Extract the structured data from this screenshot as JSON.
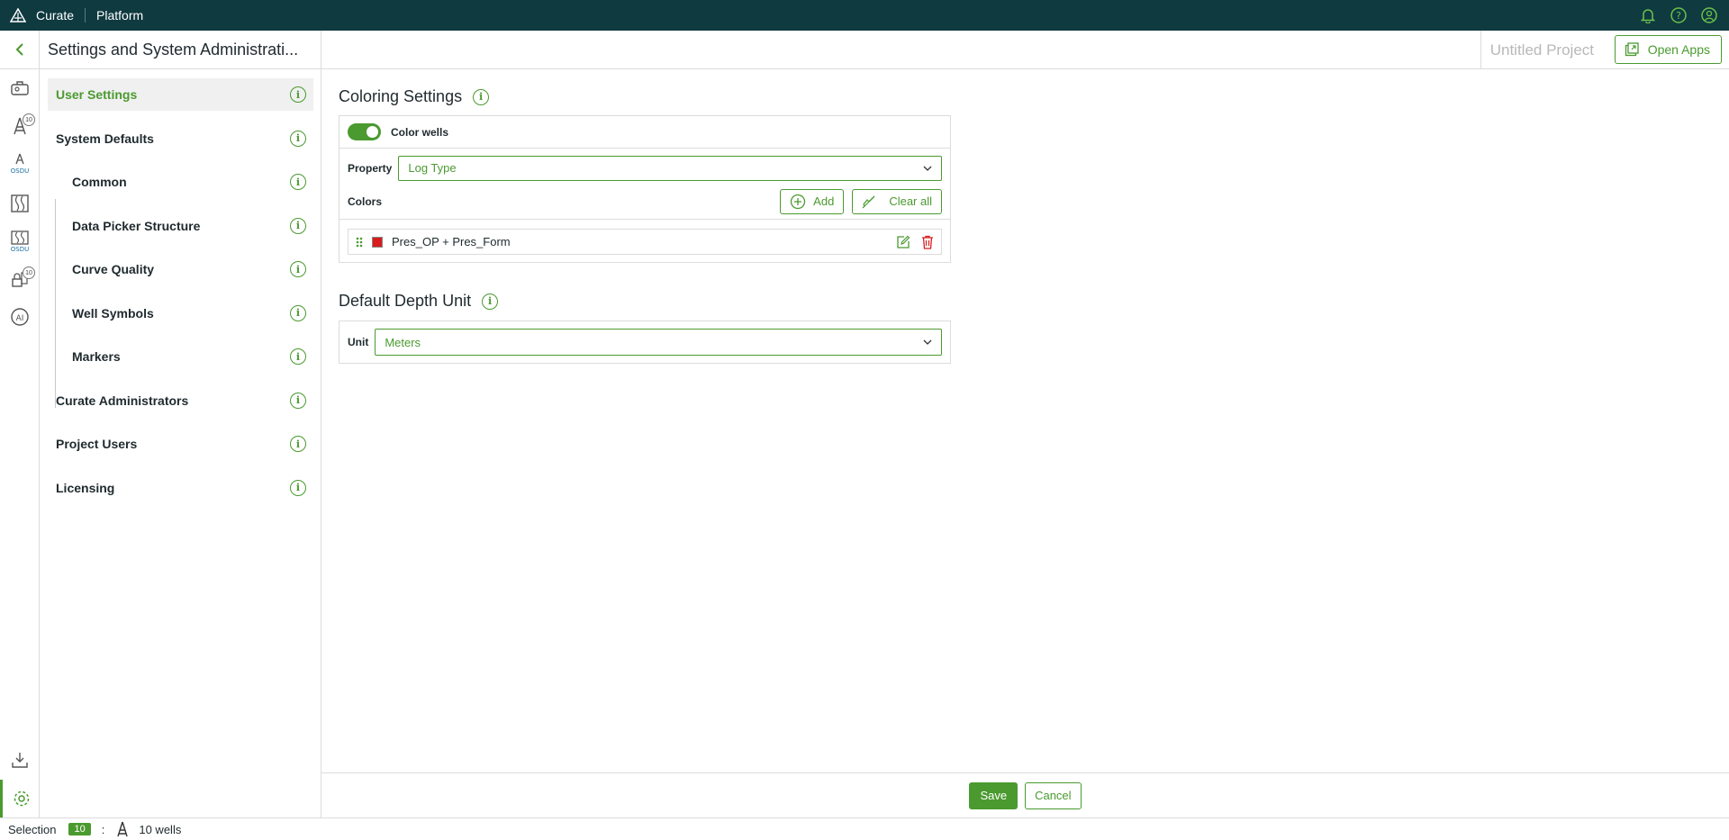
{
  "topbar": {
    "app_name": "Curate",
    "platform_label": "Platform"
  },
  "nav": {
    "title": "Settings and System Administrati...",
    "items": [
      {
        "label": "User Settings"
      },
      {
        "label": "System Defaults"
      },
      {
        "label": "Common"
      },
      {
        "label": "Data Picker Structure"
      },
      {
        "label": "Curve Quality"
      },
      {
        "label": "Well Symbols"
      },
      {
        "label": "Markers"
      },
      {
        "label": "Curate Administrators"
      },
      {
        "label": "Project Users"
      },
      {
        "label": "Licensing"
      }
    ]
  },
  "rail": {
    "badge_wells": "10",
    "badge_selection": "10",
    "osdu_label": "OSDU"
  },
  "header": {
    "project_name": "Untitled Project",
    "open_apps_label": "Open Apps"
  },
  "coloring": {
    "title": "Coloring Settings",
    "color_wells_label": "Color wells",
    "color_wells_on": true,
    "property_label": "Property",
    "property_value": "Log Type",
    "colors_label": "Colors",
    "add_label": "Add",
    "clear_label": "Clear all",
    "entries": [
      {
        "name": "Pres_OP + Pres_Form",
        "color": "#d91c1c"
      }
    ]
  },
  "depth": {
    "title": "Default Depth Unit",
    "unit_label": "Unit",
    "unit_value": "Meters"
  },
  "footer": {
    "save_label": "Save",
    "cancel_label": "Cancel"
  },
  "status": {
    "selection_label": "Selection",
    "selection_count": "10",
    "separator": ":",
    "wells_label": "10 wells"
  },
  "colors": {
    "accent": "#4a9a2f",
    "topbar": "#0f3a40",
    "danger": "#d91c1c"
  }
}
